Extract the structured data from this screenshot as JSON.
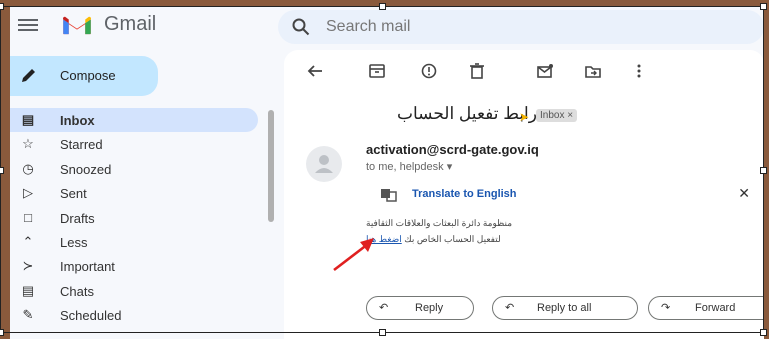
{
  "app": {
    "brand": "Gmail",
    "search_placeholder": "Search mail"
  },
  "sidebar": {
    "compose_label": "Compose",
    "items": [
      {
        "label": "Inbox",
        "icon": "inbox-icon",
        "active": true
      },
      {
        "label": "Starred",
        "icon": "star-icon"
      },
      {
        "label": "Snoozed",
        "icon": "clock-icon"
      },
      {
        "label": "Sent",
        "icon": "send-icon"
      },
      {
        "label": "Drafts",
        "icon": "draft-icon"
      },
      {
        "label": "Less",
        "icon": "chevron-up-icon"
      },
      {
        "label": "Important",
        "icon": "important-icon"
      },
      {
        "label": "Chats",
        "icon": "chat-icon"
      },
      {
        "label": "Scheduled",
        "icon": "schedule-icon"
      }
    ]
  },
  "email": {
    "subject": "رابط تفعيل الحساب",
    "label_chip": "Inbox ×",
    "sender": "activation@scrd-gate.gov.iq",
    "recipients": "to me, helpdesk ▾",
    "translate_label": "Translate to English",
    "body_line1": "منظومة دائرة البعثات والعلاقات الثقافية",
    "body_line2_prefix": "لتفعيل الحساب الخاص بك ",
    "body_link": "اضغط هنا"
  },
  "actions": {
    "reply": "Reply",
    "reply_all": "Reply to all",
    "forward": "Forward"
  },
  "colors": {
    "accent": "#c2e7ff",
    "active_nav": "#d3e3fd",
    "link": "#1a56b0",
    "annotation_arrow": "#e02020"
  }
}
